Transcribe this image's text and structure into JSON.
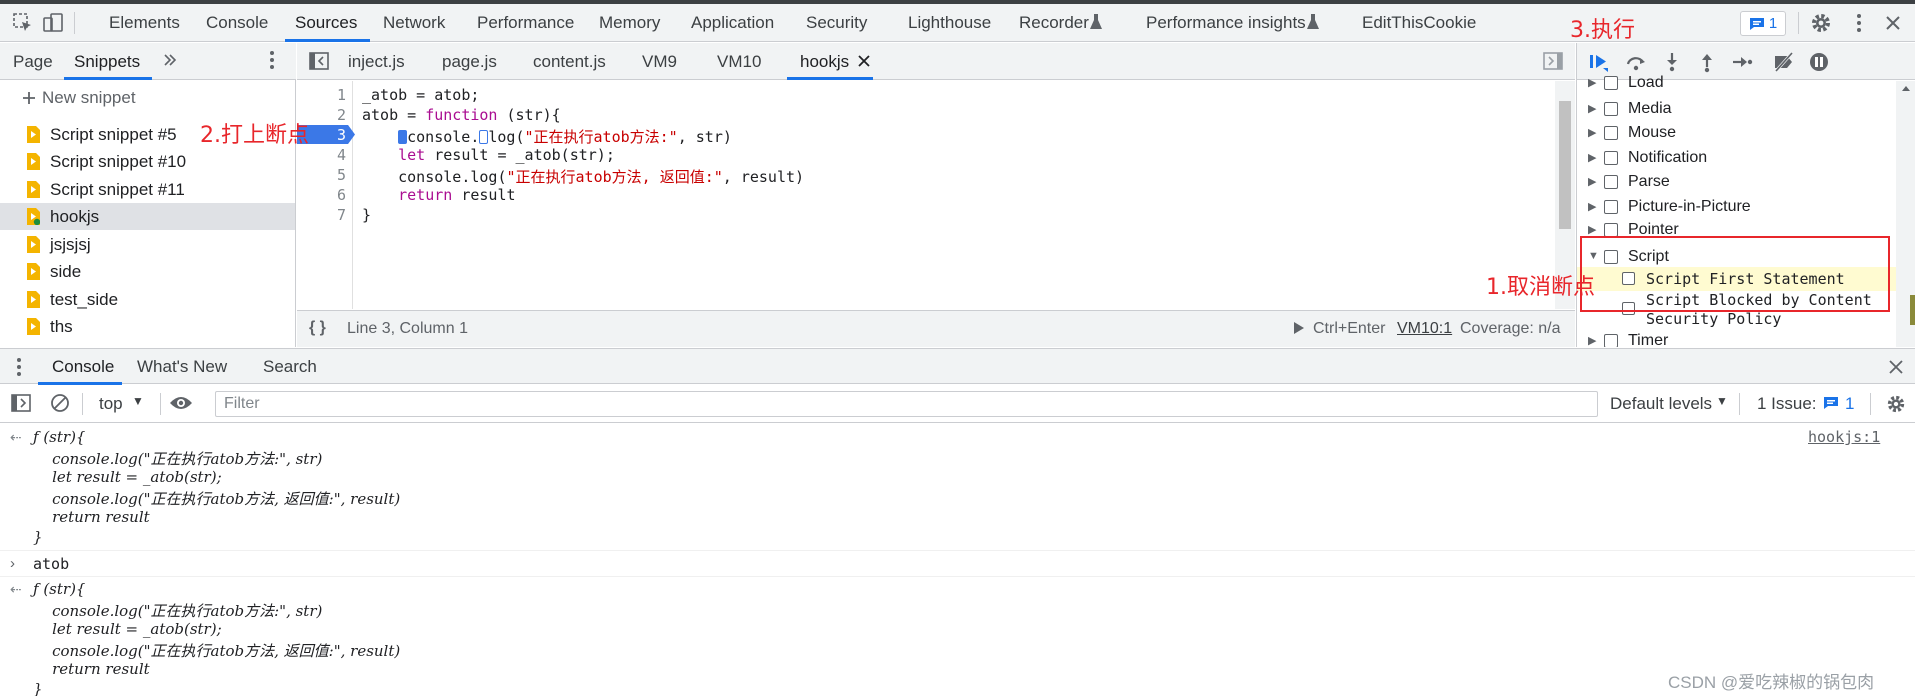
{
  "toolbar": {
    "tabs": [
      "Elements",
      "Console",
      "Sources",
      "Network",
      "Performance",
      "Memory",
      "Application",
      "Security",
      "Lighthouse",
      "Recorder",
      "Performance insights",
      "EditThisCookie"
    ],
    "active_tab": "Sources",
    "issue_count": "1"
  },
  "navigator": {
    "tabs": [
      "Page",
      "Snippets"
    ],
    "active_tab": "Snippets",
    "new_snippet": "New snippet",
    "snippets": [
      "Script snippet #5",
      "Script snippet #10",
      "Script snippet #11",
      "hookjs",
      "jsjsjsj",
      "side",
      "test_side",
      "ths"
    ],
    "selected": "hookjs"
  },
  "editor": {
    "tabs": [
      "inject.js",
      "page.js",
      "content.js",
      "VM9",
      "VM10",
      "hookjs"
    ],
    "active_tab": "hookjs",
    "line_numbers": [
      "1",
      "2",
      "3",
      "4",
      "5",
      "6",
      "7"
    ],
    "lines": [
      "_atob = atob;",
      "atob = function (str){",
      "    console.log(\"正在执行atob方法:\", str)",
      "    let result = _atob(str);",
      "    console.log(\"正在执行atob方法, 返回值:\", result)",
      "    return result",
      "}"
    ],
    "status_position": "Line 3, Column 1",
    "run_hint": "Ctrl+Enter",
    "vm_link": "VM10:1",
    "coverage": "Coverage: n/a"
  },
  "breakpoints": {
    "categories": [
      "Load",
      "Media",
      "Mouse",
      "Notification",
      "Parse",
      "Picture-in-Picture",
      "Pointer",
      "Script",
      "Timer"
    ],
    "script_children": [
      "Script First Statement",
      "Script Blocked by Content",
      "Security Policy"
    ]
  },
  "drawer": {
    "tabs": [
      "Console",
      "What's New",
      "Search"
    ],
    "active_tab": "Console",
    "context": "top",
    "filter_placeholder": "Filter",
    "levels": "Default levels",
    "issues_label": "1 Issue:",
    "issues_count": "1"
  },
  "console": {
    "output1": [
      "ƒ (str){",
      "    console.log(\"正在执行atob方法:\", str)",
      "    let result = _atob(str);",
      "    console.log(\"正在执行atob方法, 返回值:\", result)",
      "    return result",
      "}"
    ],
    "source_link": "hookjs:1",
    "input": "atob",
    "output2": [
      "ƒ (str){",
      "    console.log(\"正在执行atob方法:\", str)",
      "    let result = _atob(str);",
      "    console.log(\"正在执行atob方法, 返回值:\", result)",
      "    return result",
      "}"
    ]
  },
  "annotations": {
    "step1": "1.取消断点",
    "step2": "2.打上断点",
    "step3": "3.执行",
    "color": "#e8262b"
  },
  "watermark": "CSDN @爱吃辣椒的锅包肉",
  "colors": {
    "accent": "#1a73e8",
    "keyword": "#aa0d91",
    "string": "#c80000",
    "file_icon": "#f4b400"
  }
}
